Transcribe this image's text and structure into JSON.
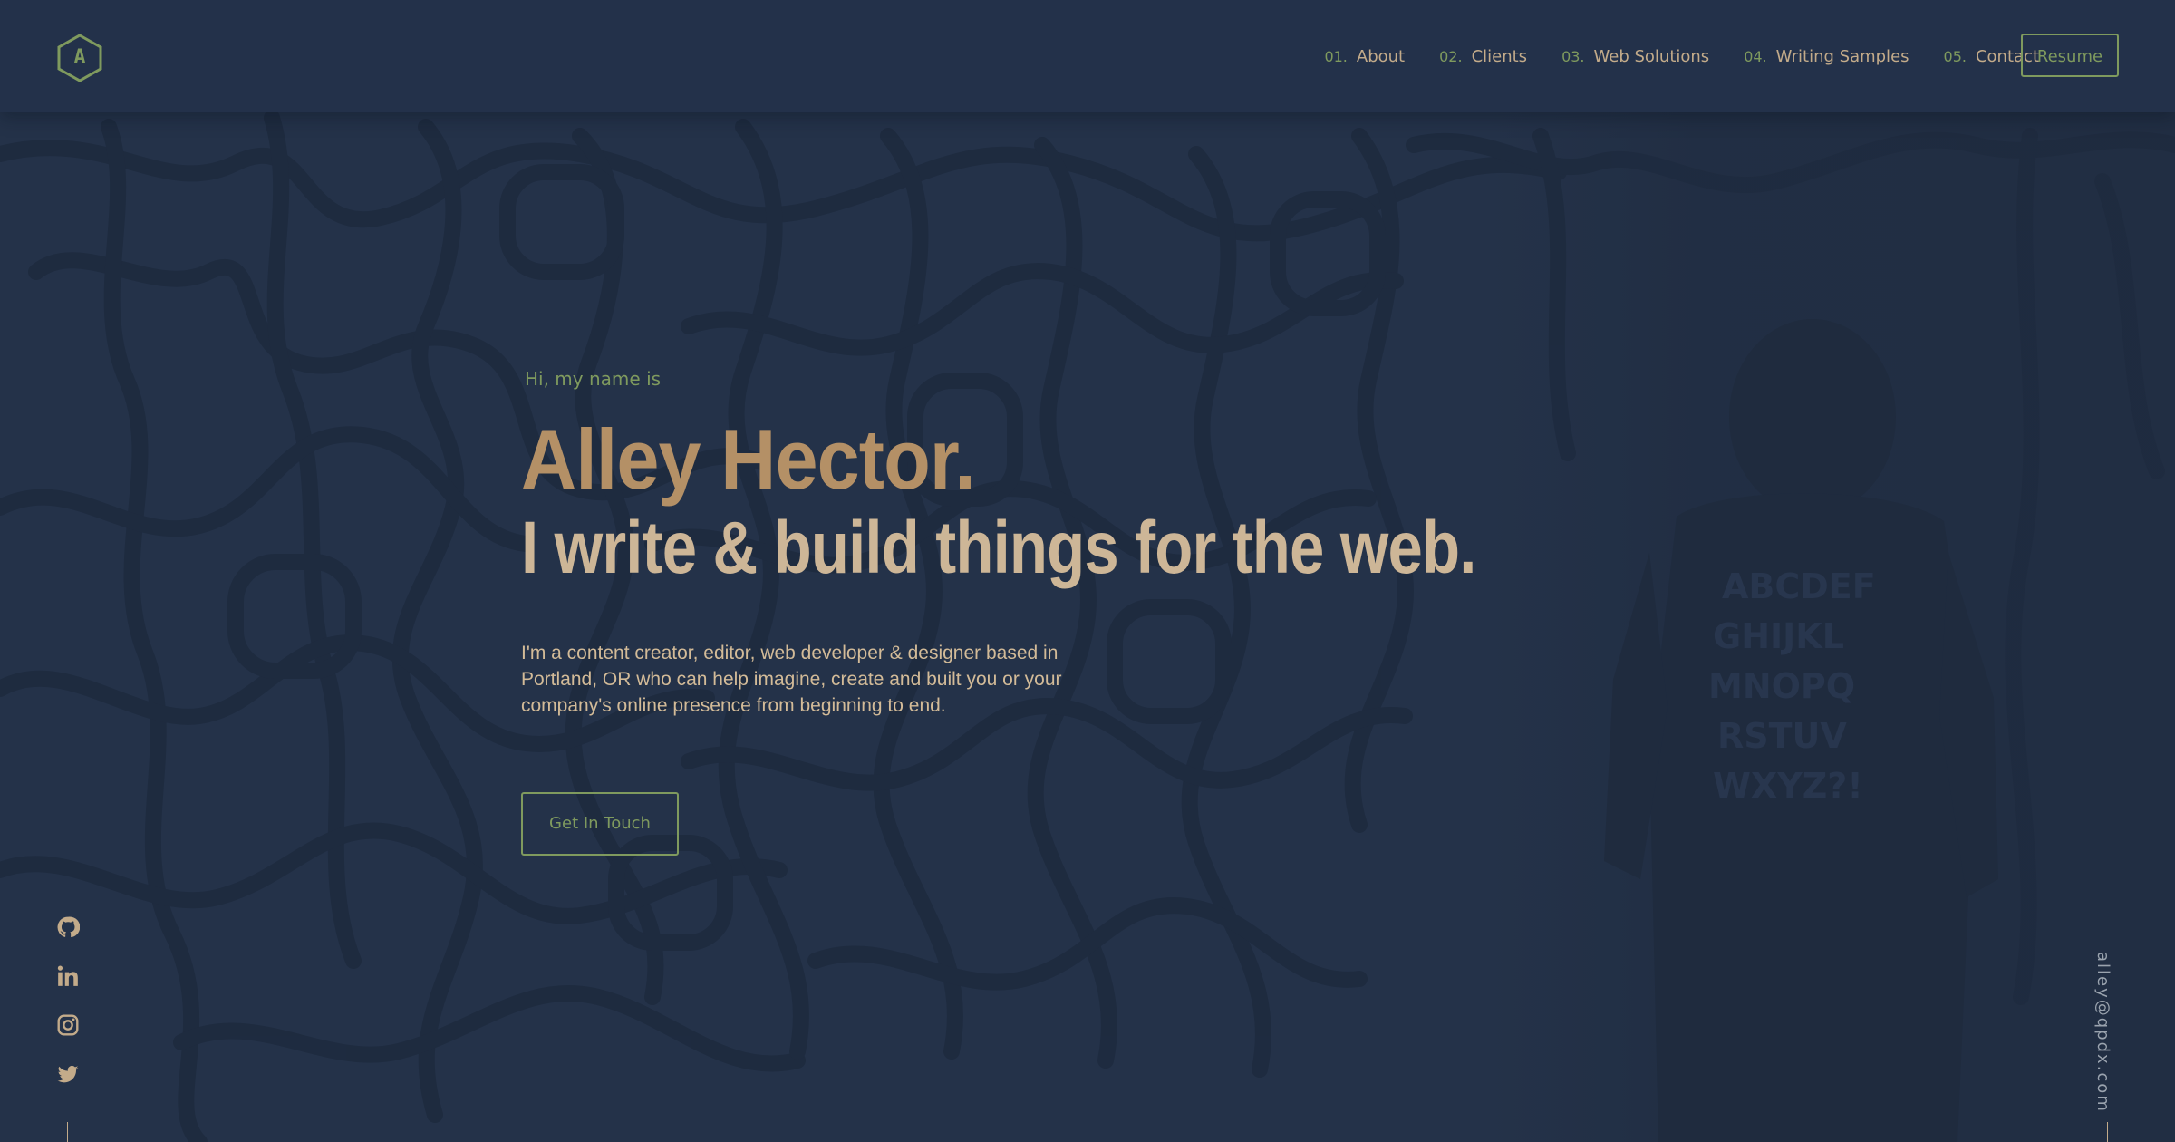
{
  "header": {
    "logo_letter": "A",
    "nav": [
      {
        "num": "01.",
        "label": "About"
      },
      {
        "num": "02.",
        "label": "Clients"
      },
      {
        "num": "03.",
        "label": "Web Solutions"
      },
      {
        "num": "04.",
        "label": "Writing Samples"
      },
      {
        "num": "05.",
        "label": "Contact"
      }
    ],
    "resume_label": "Resume"
  },
  "hero": {
    "greeting": "Hi, my name is",
    "name": "Alley Hector.",
    "tagline": "I write & build things for the web.",
    "bio": "I'm a content creator, editor, web developer & designer based in Portland, OR who can help imagine, create and built you or your company's online presence from beginning to end.",
    "cta_label": "Get In Touch"
  },
  "social": {
    "icons": [
      "github-icon",
      "linkedin-icon",
      "instagram-icon",
      "twitter-icon"
    ]
  },
  "email": "alley@qpdx.com",
  "colors": {
    "background": "#243249",
    "accent_green": "#7f9a5e",
    "name_gold": "#b49066",
    "text_tan": "#cdb697"
  }
}
